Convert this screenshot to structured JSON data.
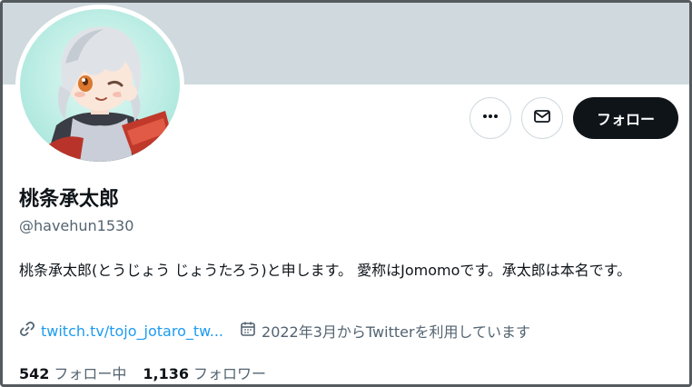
{
  "profile": {
    "display_name": "桃条承太郎",
    "handle": "@havehun1530",
    "bio": "桃条承太郎(とうじょう じょうたろう)と申します。 愛称はJomomoです。承太郎は本名です。",
    "website": "twitch.tv/tojo_jotaro_tw...",
    "joined": "2022年3月からTwitterを利用しています",
    "following_count": "542",
    "following_label": "フォロー中",
    "followers_count": "1,136",
    "followers_label": "フォロワー"
  },
  "actions": {
    "more_icon": "more-icon",
    "message_icon": "mail-icon",
    "follow_label": "フォロー"
  },
  "icons": {
    "website": "link-icon",
    "joined": "calendar-icon"
  },
  "colors": {
    "banner": "#cfd9de",
    "link": "#1d9bf0",
    "secondary_text": "#536471",
    "follow_button": "#0f1419"
  }
}
